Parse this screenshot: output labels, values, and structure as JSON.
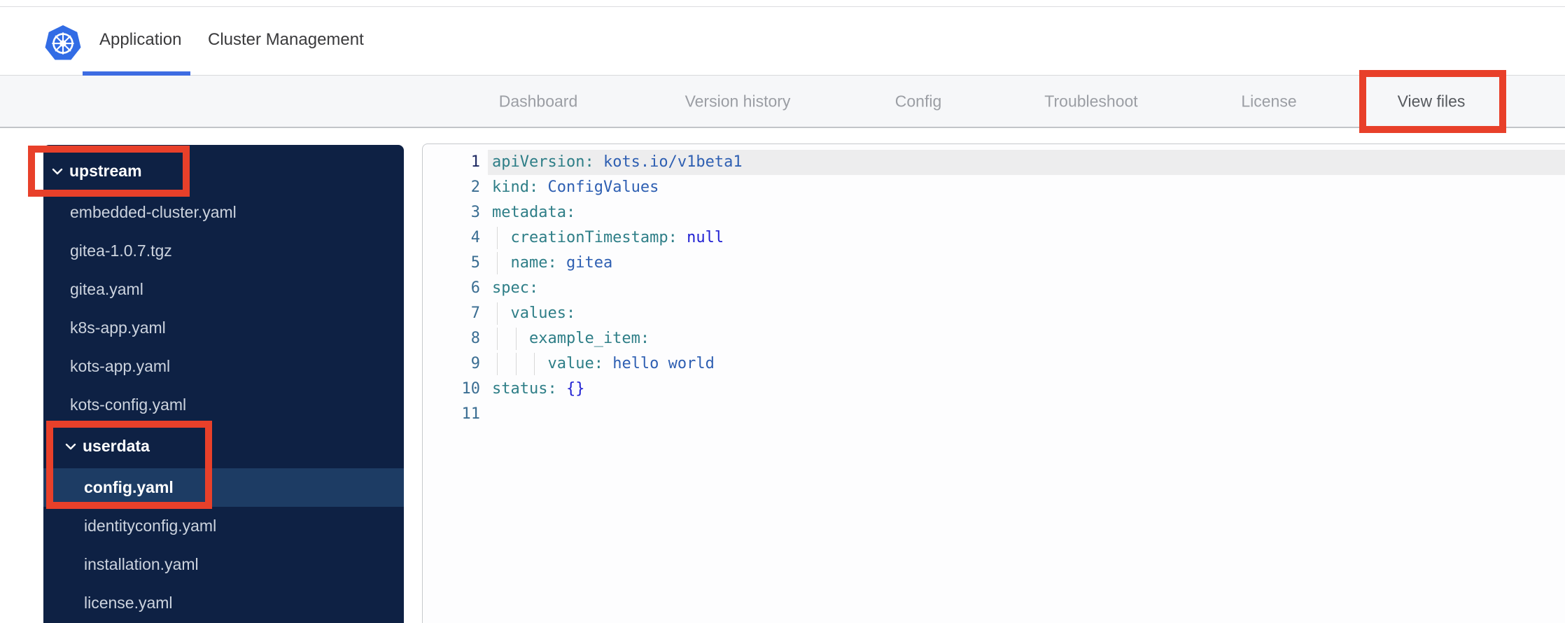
{
  "colors": {
    "annotation_red": "#e8402a",
    "active_underline_blue": "#3d6ce2",
    "subnav_underline_blue": "#4272e2",
    "sidebar_bg": "#0e2144",
    "sidebar_selected_bg": "#1d3c64",
    "kubernetes_logo_blue": "#326ce5",
    "code_key_teal": "#2e7e87",
    "code_value_blue": "#2e5fb2",
    "code_special_blue": "#2121d3"
  },
  "icons": {
    "logo": "kubernetes-logo",
    "folder_chevron": "chevron-down-icon"
  },
  "header": {
    "tabs": [
      {
        "label": "Application",
        "active": true
      },
      {
        "label": "Cluster Management",
        "active": false
      }
    ]
  },
  "subnav": {
    "tabs": [
      {
        "label": "Dashboard",
        "active": false
      },
      {
        "label": "Version history",
        "active": false
      },
      {
        "label": "Config",
        "active": false
      },
      {
        "label": "Troubleshoot",
        "active": false
      },
      {
        "label": "License",
        "active": false
      },
      {
        "label": "View files",
        "active": true
      }
    ]
  },
  "file_tree": {
    "items": [
      {
        "label": "upstream",
        "type": "folder",
        "level": 0,
        "expanded": true,
        "selected": false
      },
      {
        "label": "embedded-cluster.yaml",
        "type": "file",
        "level": 1,
        "selected": false
      },
      {
        "label": "gitea-1.0.7.tgz",
        "type": "file",
        "level": 1,
        "selected": false
      },
      {
        "label": "gitea.yaml",
        "type": "file",
        "level": 1,
        "selected": false
      },
      {
        "label": "k8s-app.yaml",
        "type": "file",
        "level": 1,
        "selected": false
      },
      {
        "label": "kots-app.yaml",
        "type": "file",
        "level": 1,
        "selected": false
      },
      {
        "label": "kots-config.yaml",
        "type": "file",
        "level": 1,
        "selected": false
      },
      {
        "label": "userdata",
        "type": "folder",
        "level": 1,
        "expanded": true,
        "selected": false
      },
      {
        "label": "config.yaml",
        "type": "file",
        "level": 2,
        "selected": true
      },
      {
        "label": "identityconfig.yaml",
        "type": "file",
        "level": 2,
        "selected": false
      },
      {
        "label": "installation.yaml",
        "type": "file",
        "level": 2,
        "selected": false
      },
      {
        "label": "license.yaml",
        "type": "file",
        "level": 2,
        "selected": false
      }
    ]
  },
  "editor": {
    "lines": [
      {
        "n": "1",
        "active": true,
        "guides": 0,
        "tokens": [
          {
            "c": "key",
            "t": "apiVersion:"
          },
          {
            "c": "val",
            "t": " kots.io/v1beta1"
          }
        ]
      },
      {
        "n": "2",
        "guides": 0,
        "tokens": [
          {
            "c": "key",
            "t": "kind:"
          },
          {
            "c": "val",
            "t": " ConfigValues"
          }
        ]
      },
      {
        "n": "3",
        "guides": 0,
        "tokens": [
          {
            "c": "key",
            "t": "metadata:"
          }
        ]
      },
      {
        "n": "4",
        "guides": 1,
        "tokens": [
          {
            "c": "key",
            "t": "  creationTimestamp:"
          },
          {
            "c": "special",
            "t": " null"
          }
        ]
      },
      {
        "n": "5",
        "guides": 1,
        "tokens": [
          {
            "c": "key",
            "t": "  name:"
          },
          {
            "c": "val",
            "t": " gitea"
          }
        ]
      },
      {
        "n": "6",
        "guides": 0,
        "tokens": [
          {
            "c": "key",
            "t": "spec:"
          }
        ]
      },
      {
        "n": "7",
        "guides": 1,
        "tokens": [
          {
            "c": "key",
            "t": "  values:"
          }
        ]
      },
      {
        "n": "8",
        "guides": 2,
        "tokens": [
          {
            "c": "key",
            "t": "    example_item:"
          }
        ]
      },
      {
        "n": "9",
        "guides": 3,
        "tokens": [
          {
            "c": "key",
            "t": "      value:"
          },
          {
            "c": "val",
            "t": " hello world"
          }
        ]
      },
      {
        "n": "10",
        "guides": 0,
        "tokens": [
          {
            "c": "key",
            "t": "status:"
          },
          {
            "c": "special",
            "t": " {}"
          }
        ]
      },
      {
        "n": "11",
        "guides": 0,
        "tokens": []
      }
    ]
  },
  "annotations": {
    "boxes": [
      "upstream-folder",
      "userdata-and-config-yaml",
      "view-files-tab"
    ]
  }
}
